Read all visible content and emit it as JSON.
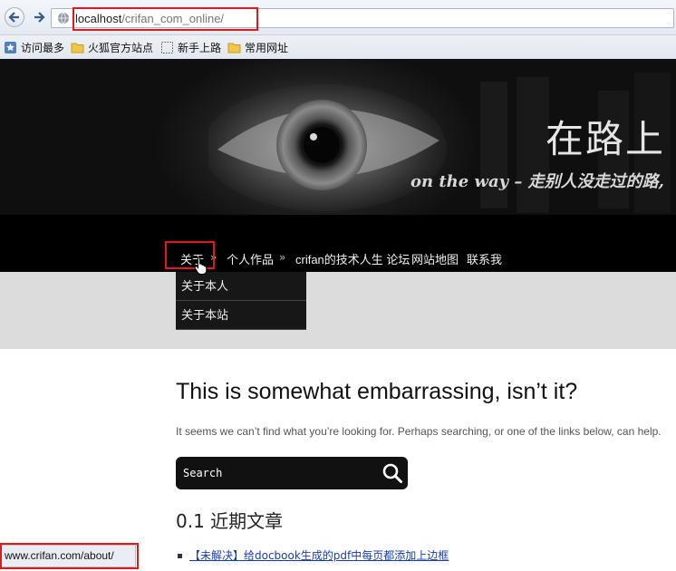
{
  "browser": {
    "url_host": "localhost",
    "url_path": "/crifan_com_online/",
    "bookmarks": [
      {
        "label": "访问最多",
        "icon": "bookmark-star-icon"
      },
      {
        "label": "火狐官方站点",
        "icon": "folder-icon"
      },
      {
        "label": "新手上路",
        "icon": "dotted-folder-icon"
      },
      {
        "label": "常用网址",
        "icon": "folder-icon"
      }
    ],
    "status_url": "www.crifan.com/about/"
  },
  "header": {
    "title": "在路上",
    "tagline": "on the way – 走别人没走过的路,"
  },
  "nav": {
    "items": [
      "关于",
      "个人作品",
      "crifan的技术人生 论坛",
      "网站地图",
      "联系我"
    ],
    "separator": "»",
    "dropdown": [
      "关于本人",
      "关于本站"
    ]
  },
  "content": {
    "heading": "This is somewhat embarrassing, isn’t it?",
    "message": "It seems we can’t find what you’re looking for. Perhaps searching, or one of the links below, can help.",
    "search_placeholder": "Search",
    "recent_heading": "0.1 近期文章",
    "recent_posts": [
      "【未解决】给docbook生成的pdf中每页都添加上边框"
    ]
  },
  "colors": {
    "highlight": "#e0191f",
    "nav_bg": "#000000",
    "link": "#1a3fb0"
  }
}
